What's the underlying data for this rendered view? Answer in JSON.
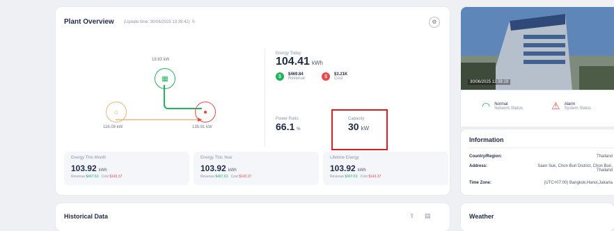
{
  "overview": {
    "title": "Plant Overview",
    "update_time": "(Update time: 30/06/2025 13:39:42)",
    "flow": {
      "pv_power": "19.83 kW",
      "grid_power": "116.08 kW",
      "load_power": "135.91 kW"
    },
    "energy_today": {
      "label": "Energy Today",
      "value": "104.41",
      "unit": "kWh"
    },
    "revenue": {
      "value": "$469.84",
      "label": "Revenue"
    },
    "cost": {
      "value": "$3.21K",
      "label": "Cost"
    },
    "power_ratio": {
      "label": "Power Ratio",
      "value": "66.1",
      "unit": "%"
    },
    "capacity": {
      "label": "Capacity",
      "value": "30",
      "unit": "kW"
    },
    "stats": [
      {
        "label": "Energy This Month",
        "value": "103.92",
        "unit": "kWh",
        "revenue_label": "Revenue",
        "revenue": "$467.63",
        "cost_label": "Cost",
        "cost": "$143.37"
      },
      {
        "label": "Energy This Year",
        "value": "103.92",
        "unit": "kWh",
        "revenue_label": "Revenue",
        "revenue": "$467.63",
        "cost_label": "Cost",
        "cost": "$143.37"
      },
      {
        "label": "Lifetime Energy",
        "value": "103.92",
        "unit": "kWh",
        "revenue_label": "Revenue",
        "revenue": "$467.63",
        "cost_label": "Cost",
        "cost": "$143.37"
      }
    ]
  },
  "historical": {
    "title": "Historical Data"
  },
  "photo": {
    "timestamp": "30/06/2025 13:38:19"
  },
  "status": {
    "network": {
      "value": "Normal",
      "label": "Network Status"
    },
    "alarm": {
      "value": "Alarm",
      "label": "System Status"
    }
  },
  "information": {
    "title": "Information",
    "country_label": "Country/Region:",
    "country": "Thailand",
    "address_label": "Address:",
    "address": "Saen Suk, Chon Buri District, Chon Buri, Thailand",
    "timezone_label": "Time Zone:",
    "timezone": "(UTC+07:00) Bangkok,Hanoi,Jakarta"
  },
  "weather": {
    "title": "Weather"
  },
  "colors": {
    "accent": "#21b35b",
    "alarm": "#e74a4a",
    "highlight": "#e01b1b"
  }
}
